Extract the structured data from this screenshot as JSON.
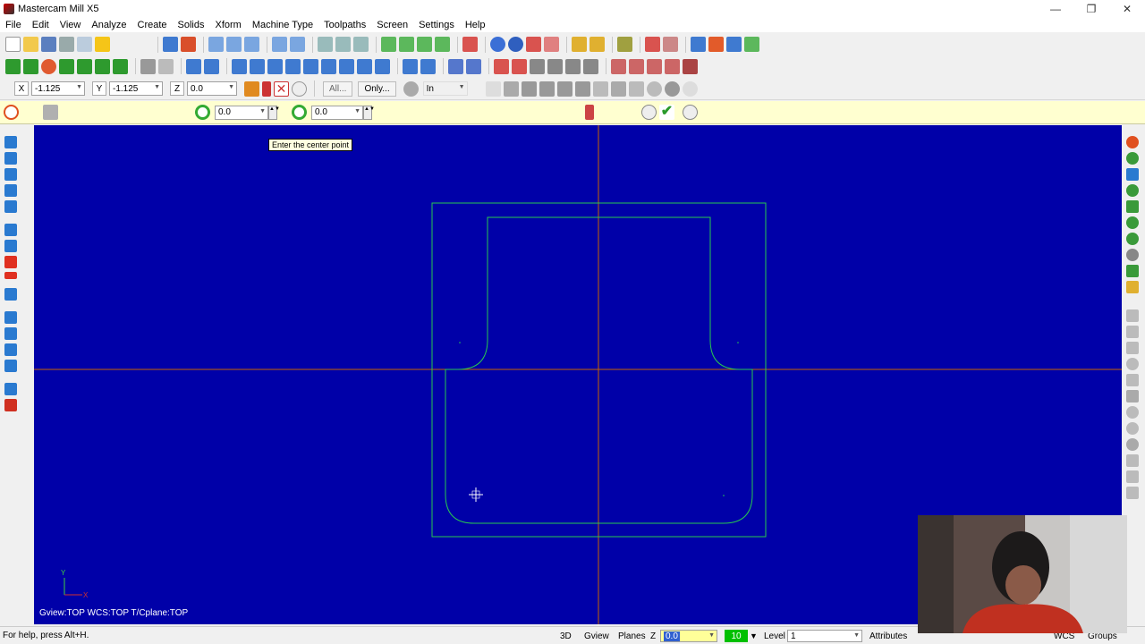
{
  "window": {
    "title": "Mastercam Mill X5",
    "minimize": "—",
    "maximize": "❐",
    "close": "✕"
  },
  "menu": [
    "File",
    "Edit",
    "View",
    "Analyze",
    "Create",
    "Solids",
    "Xform",
    "Machine Type",
    "Toolpaths",
    "Screen",
    "Settings",
    "Help"
  ],
  "autocursor": {
    "x_label": "X",
    "x_value": "-1.125",
    "y_label": "Y",
    "y_value": "-1.125",
    "z_label": "Z",
    "z_value": "0.0",
    "all_button": "All...",
    "only_button": "Only...",
    "units": "In"
  },
  "ribbon": {
    "field1_value": "0.0",
    "field2_value": "0.0"
  },
  "viewport": {
    "prompt": "Enter the center point",
    "axis_y": "Y",
    "axis_x": "X",
    "status": "Gview:TOP   WCS:TOP   T/Cplane:TOP",
    "background_color": "#0000a8",
    "geometry_color": "#28c850",
    "axis_color": "#c86400"
  },
  "statusbar": {
    "help": "For help, press Alt+H.",
    "mode_3d": "3D",
    "gview": "Gview",
    "planes": "Planes",
    "z_label": "Z",
    "z_value": "0.0",
    "color_value": "10",
    "level_label": "Level",
    "level_value": "1",
    "attributes": "Attributes",
    "wcs": "WCS",
    "groups": "Groups"
  }
}
